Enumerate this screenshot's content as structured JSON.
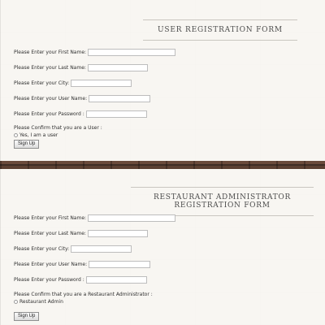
{
  "user_form": {
    "title": "USER REGISTRATION FORM",
    "labels": {
      "first": "Please Enter your First Name:",
      "last": "Please Enter your Last Name:",
      "city": "Please Enter your City:",
      "user": "Please Enter your User Name:",
      "pass": "Please Enter your Password :"
    },
    "confirm": "Please Confirm that you are a User :",
    "radio_label": "Yes, I am a user",
    "submit": "Sign Up"
  },
  "admin_form": {
    "title": "RESTAURANT ADMINISTRATOR REGISTRATION FORM",
    "labels": {
      "first": "Please Enter your First Name:",
      "last": "Please Enter your Last Name:",
      "city": "Please Enter your City:",
      "user": "Please Enter your User Name:",
      "pass": "Please Enter your Password :"
    },
    "confirm": "Please Confirm that you are a Restaurant Administrator :",
    "radio_label": "Restaurant Admin",
    "submit": "Sign Up"
  }
}
